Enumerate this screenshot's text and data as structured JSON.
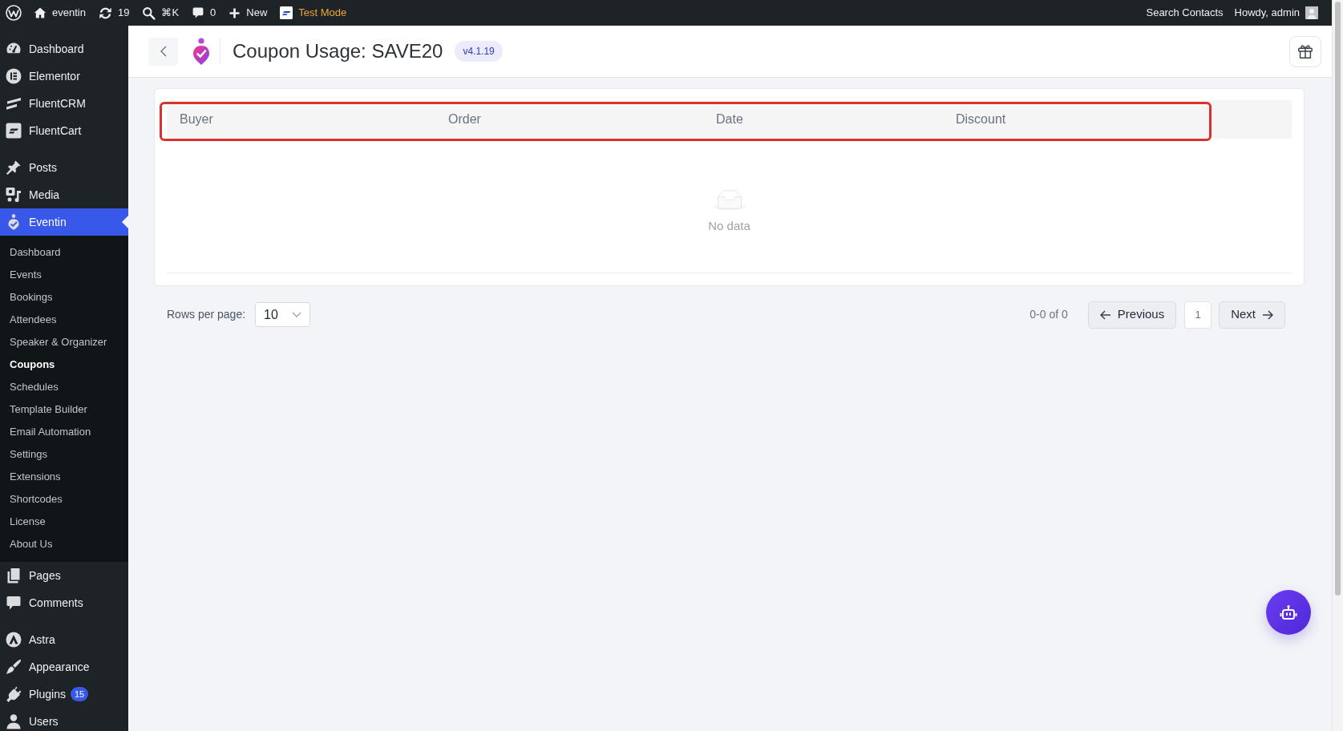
{
  "admin_bar": {
    "items": [
      {
        "label": "eventin",
        "highlighted": false
      },
      {
        "label": "19",
        "highlighted": false
      },
      {
        "label": "⌘K",
        "highlighted": false
      },
      {
        "label": "0",
        "highlighted": false
      },
      {
        "label": "New",
        "highlighted": false
      },
      {
        "label": "Test Mode",
        "highlighted": true
      }
    ],
    "right_items": [
      {
        "label": "Search Contacts"
      },
      {
        "label": "Howdy, admin"
      }
    ]
  },
  "sidebar": {
    "groups": [
      {
        "items": [
          {
            "label": "Dashboard",
            "selected": false
          },
          {
            "label": "Elementor",
            "selected": false
          },
          {
            "label": "FluentCRM",
            "selected": false
          },
          {
            "label": "FluentCart",
            "selected": false
          }
        ]
      },
      {
        "items": [
          {
            "label": "Posts",
            "selected": false
          },
          {
            "label": "Media",
            "selected": false
          },
          {
            "label": "Eventin",
            "selected": true,
            "children": [
              {
                "label": "Dashboard",
                "selected": false
              },
              {
                "label": "Events",
                "selected": false
              },
              {
                "label": "Bookings",
                "selected": false
              },
              {
                "label": "Attendees",
                "selected": false
              },
              {
                "label": "Speaker & Organizer",
                "selected": false
              },
              {
                "label": "Coupons",
                "selected": true
              },
              {
                "label": "Schedules",
                "selected": false
              },
              {
                "label": "Template Builder",
                "selected": false
              },
              {
                "label": "Email Automation",
                "selected": false
              },
              {
                "label": "Settings",
                "selected": false
              },
              {
                "label": "Extensions",
                "selected": false
              },
              {
                "label": "Shortcodes",
                "selected": false
              },
              {
                "label": "License",
                "selected": false
              },
              {
                "label": "About Us",
                "selected": false
              }
            ]
          },
          {
            "label": "Pages",
            "selected": false
          },
          {
            "label": "Comments",
            "selected": false
          }
        ]
      },
      {
        "items": [
          {
            "label": "Astra",
            "selected": false
          },
          {
            "label": "Appearance",
            "selected": false
          },
          {
            "label": "Plugins",
            "selected": false,
            "badge": "15"
          },
          {
            "label": "Users",
            "selected": false
          }
        ]
      }
    ]
  },
  "page_header": {
    "title": "Coupon Usage: SAVE20",
    "version": "v4.1.19"
  },
  "table": {
    "header_highlighted": true,
    "columns": [
      "Buyer",
      "Order",
      "Date",
      "Discount"
    ],
    "empty_text": "No data"
  },
  "pagination": {
    "rows_per_page_label": "Rows per page:",
    "rows_per_page": "10",
    "range": "0-0 of 0",
    "previous": "Previous",
    "pages": [
      {
        "label": "1",
        "selected": true
      }
    ],
    "next": "Next"
  }
}
